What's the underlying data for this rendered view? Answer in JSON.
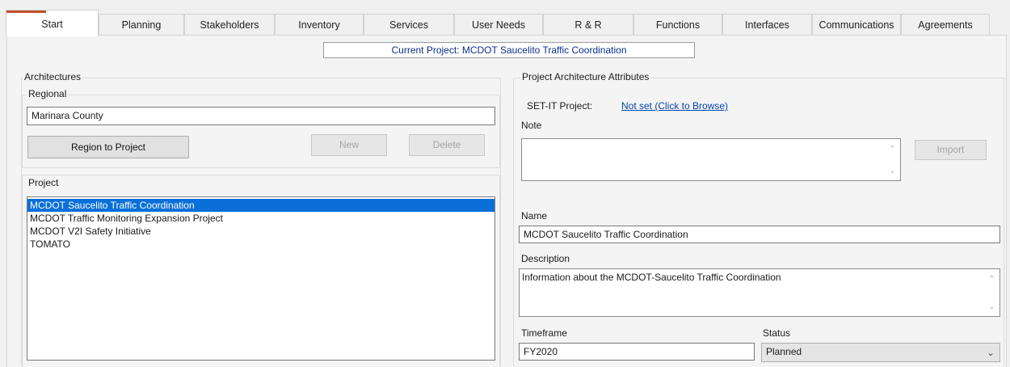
{
  "tabs": [
    "Start",
    "Planning",
    "Stakeholders",
    "Inventory",
    "Services",
    "User Needs",
    "R & R",
    "Functions",
    "Interfaces",
    "Communications",
    "Agreements"
  ],
  "current_project_label": "Current Project: MCDOT Saucelito Traffic Coordination",
  "architectures": {
    "title": "Architectures",
    "regional": {
      "title": "Regional",
      "region_value": "Marinara County",
      "region_to_project_label": "Region to Project",
      "new_label": "New",
      "delete_label": "Delete"
    },
    "project": {
      "title": "Project",
      "items": [
        "MCDOT Saucelito Traffic Coordination",
        "MCDOT Traffic Monitoring Expansion Project",
        "MCDOT V2I Safety Initiative",
        "TOMATO"
      ],
      "selected_index": 0
    }
  },
  "attributes": {
    "title": "Project Architecture Attributes",
    "setit_label": "SET-IT Project:",
    "setit_link": "Not set (Click to Browse)",
    "note_label": "Note",
    "note_value": "",
    "import_label": "Import",
    "name_label": "Name",
    "name_value": "MCDOT Saucelito Traffic Coordination",
    "description_label": "Description",
    "description_value": "Information about the MCDOT-Saucelito Traffic Coordination",
    "timeframe_label": "Timeframe",
    "timeframe_value": "FY2020",
    "status_label": "Status",
    "status_value": "Planned"
  },
  "icons": {
    "scroll_up": "chevron-up-icon",
    "scroll_down": "chevron-down-icon",
    "dropdown": "chevron-down-icon"
  },
  "colors": {
    "selection": "#0a6fd8",
    "link": "#0645ad",
    "current_project_text": "#0b2f8c",
    "tab_accent": "#c0502e"
  }
}
